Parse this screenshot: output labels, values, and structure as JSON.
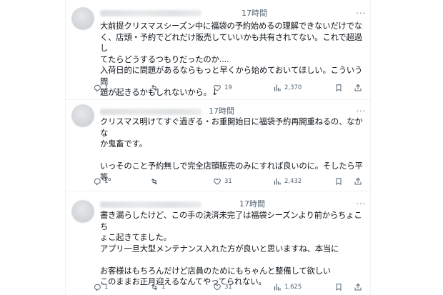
{
  "tweets": [
    {
      "time": "17時間",
      "text": "大前提クリスマスシーズン中に福袋の予約始めるの理解できないだけでな\nく、店頭・予約でどれだけ販売していいかも共有されてない。これで超過し\nてたらどうするつもりだったのか....\n入荷日的に問題があるならもっと早くから始めておいてほしい。こういう問\n題が起きるかもしれないから。↓",
      "replies": "1",
      "retweets": "",
      "likes": "19",
      "views": "2,370"
    },
    {
      "time": "17時間",
      "text": "クリスマス明けてすぐ過ぎる・お重開始日に福袋予約再開重ねるの、なかな\nか鬼畜です。\n\nいっそのこと予約無しで完全店頭販売のみにすれば良いのに。そしたら平\n等。",
      "replies": "1",
      "retweets": "",
      "likes": "31",
      "views": "2,432"
    },
    {
      "time": "17時間",
      "text": "書き漏らしたけど、この手の決済未完了は福袋シーズンより前からちょこち\nょこ起きてました。\nアプリ一旦大型メンテナンス入れた方が良いと思いますね、本当に\n\nお客様はもちろんだけど店員のためにもちゃんと整備して欲しい\nこのままお正月迎えるなんてやってられない。",
      "replies": "1",
      "retweets": "1",
      "likes": "31",
      "views": "1,625"
    }
  ],
  "icons": {
    "reply": "reply-icon",
    "retweet": "retweet-icon",
    "like": "heart-icon",
    "views": "views-icon",
    "bookmark": "bookmark-icon",
    "share": "share-icon"
  },
  "more_glyph": "···"
}
